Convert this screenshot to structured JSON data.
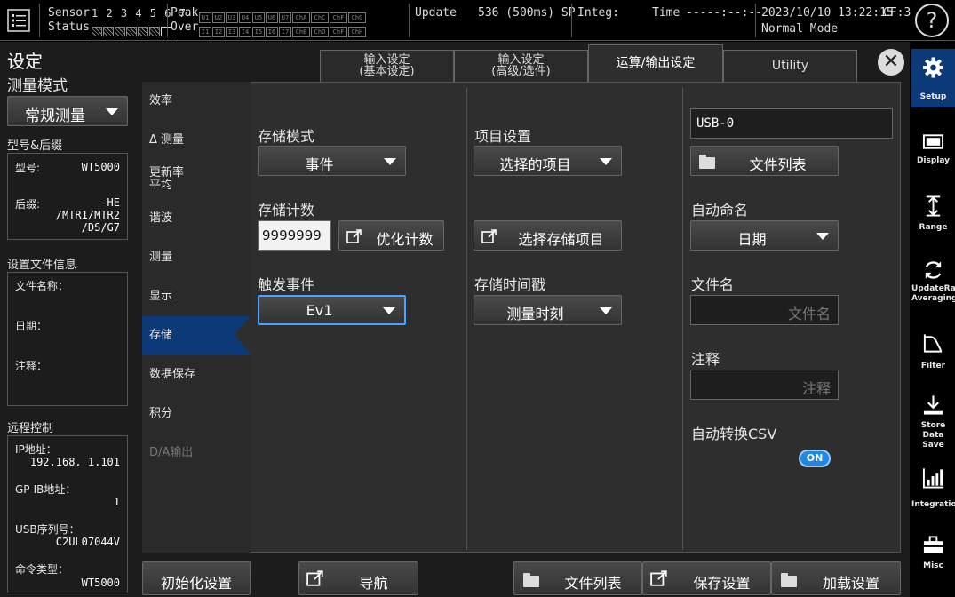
{
  "topbar": {
    "sensor_label": "Sensor",
    "status_label": "Status",
    "sensor_numbers": "1 2 3 4 5 6 7",
    "peak_label": "Peak",
    "over_label": "Over",
    "peak_channels": [
      "U1",
      "U2",
      "U3",
      "U4",
      "U5",
      "U6",
      "U7",
      "ChA",
      "ChC",
      "ChF",
      "ChG"
    ],
    "over_channels": [
      "I1",
      "I2",
      "I3",
      "I4",
      "I5",
      "I6",
      "I7",
      "ChB",
      "ChD",
      "ChF",
      "ChH"
    ],
    "update_label": "Update",
    "update_value": "536 (500ms) SP",
    "integ_label": "Integ:",
    "time_label": "Time",
    "time_value": "-----:--:--",
    "datetime": "2023/10/10 13:22:15",
    "cf": "CF:3",
    "mode": "Normal Mode",
    "help_glyph": "?"
  },
  "main": {
    "title": "设定",
    "close_glyph": "✕"
  },
  "left": {
    "measure_mode_label": "测量模式",
    "measure_mode_value": "常规测量",
    "model_section_label": "型号&后缀",
    "model_label": "型号:",
    "model_value": "WT5000",
    "suffix_label": "后缀:",
    "suffix_value_l1": "-HE",
    "suffix_value_l2": "/MTR1/MTR2",
    "suffix_value_l3": "/DS/G7",
    "file_info_label": "设置文件信息",
    "file_name_label": "文件名称：",
    "date_label": "日期：",
    "comment_label": "注释：",
    "remote_label": "远程控制",
    "ip_label": "IP地址：",
    "ip_value": "192.168.  1.101",
    "gpib_label": "GP-IB地址：",
    "gpib_value": "1",
    "usb_serial_label": "USB序列号：",
    "usb_serial_value": "C2UL07044V",
    "cmd_type_label": "命令类型：",
    "cmd_type_value": "WT5000"
  },
  "tabs": [
    {
      "l1": "输入设定",
      "l2": "(基本设定)",
      "active": false
    },
    {
      "l1": "输入设定",
      "l2": "(高级/选件)",
      "active": false
    },
    {
      "l1": "运算/输出设定",
      "l2": "",
      "active": true
    },
    {
      "l1": "Utility",
      "l2": "",
      "active": false
    }
  ],
  "categories": [
    {
      "l1": "效率",
      "l2": ""
    },
    {
      "l1": "Δ 测量",
      "l2": ""
    },
    {
      "l1": "更新率",
      "l2": "平均"
    },
    {
      "l1": "谐波",
      "l2": ""
    },
    {
      "l1": "测量",
      "l2": ""
    },
    {
      "l1": "显示",
      "l2": ""
    },
    {
      "l1": "存储",
      "l2": ""
    },
    {
      "l1": "数据保存",
      "l2": ""
    },
    {
      "l1": "积分",
      "l2": ""
    },
    {
      "l1": "D/A输出",
      "l2": ""
    }
  ],
  "content": {
    "store_mode_label": "存储模式",
    "store_mode_value": "事件",
    "store_count_label": "存储计数",
    "store_count_value": "9999999",
    "optimize_count_button": "优化计数",
    "trigger_event_label": "触发事件",
    "trigger_event_value": "Ev1",
    "item_settings_label": "项目设置",
    "item_settings_value": "选择的项目",
    "select_items_button": "选择存储项目",
    "store_timestamp_label": "存储时间戳",
    "store_timestamp_value": "测量时刻",
    "drive_value": "USB-0",
    "file_list_button": "文件列表",
    "auto_naming_label": "自动命名",
    "auto_naming_value": "日期",
    "file_name_label": "文件名",
    "file_name_placeholder": "文件名",
    "comment_label": "注释",
    "comment_placeholder": "注释",
    "auto_csv_label": "自动转换CSV",
    "auto_csv_toggle": "ON"
  },
  "bottom": {
    "init_button": "初始化设置",
    "nav_button": "导航",
    "file_list_button": "文件列表",
    "save_settings_button": "保存设置",
    "load_settings_button": "加载设置"
  },
  "sidebar": [
    {
      "l1": "Setup",
      "l2": "",
      "icon": "gear-icon"
    },
    {
      "l1": "Display",
      "l2": "",
      "icon": "display-icon"
    },
    {
      "l1": "Range",
      "l2": "",
      "icon": "range-icon"
    },
    {
      "l1": "UpdateRate",
      "l2": "Averaging",
      "icon": "refresh-icon"
    },
    {
      "l1": "Filter",
      "l2": "",
      "icon": "filter-icon"
    },
    {
      "l1": "Store",
      "l2": "Data Save",
      "icon": "download-icon"
    },
    {
      "l1": "Integration",
      "l2": "",
      "icon": "integration-icon"
    },
    {
      "l1": "Misc",
      "l2": "",
      "icon": "toolbox-icon"
    }
  ],
  "colors": {
    "accent": "#0c3a78",
    "toggle_on": "#1e88e5",
    "panel": "#2e2e2e"
  }
}
